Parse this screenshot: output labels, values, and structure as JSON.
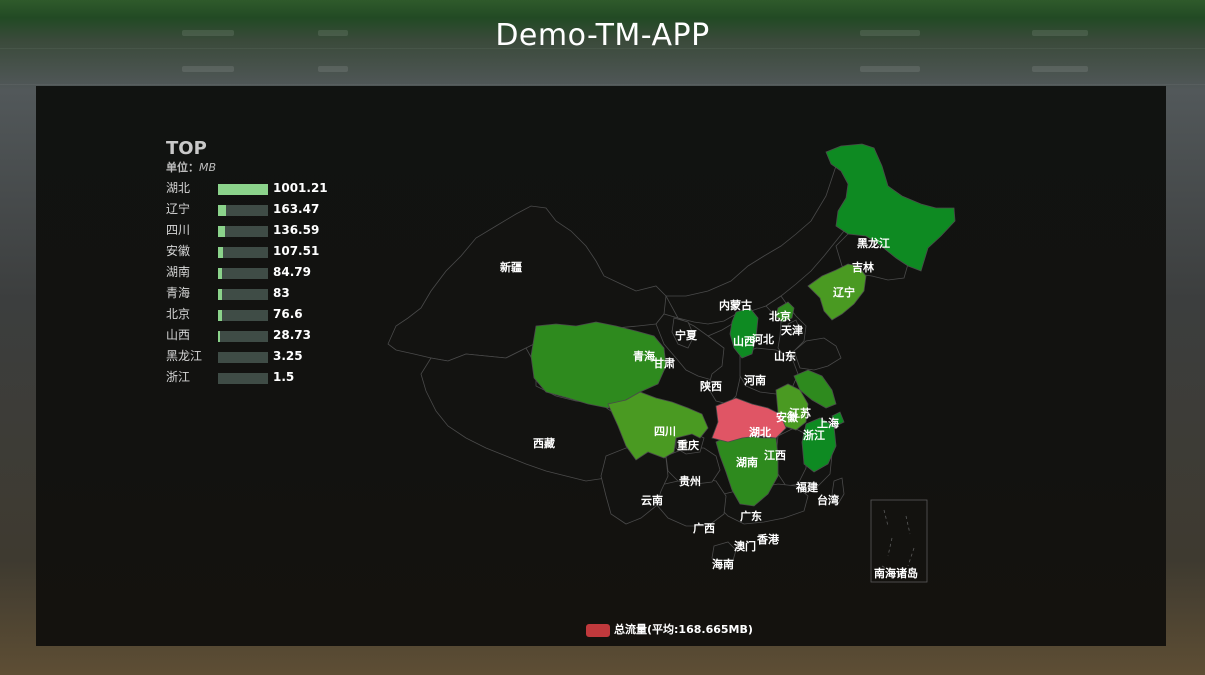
{
  "app": {
    "title": "Demo-TM-APP"
  },
  "top_list": {
    "title": "TOP",
    "unit_label": "单位：",
    "unit_value": "MB",
    "max_value": 1001.21,
    "items": [
      {
        "name": "湖北",
        "value": "1001.21",
        "num": 1001.21
      },
      {
        "name": "辽宁",
        "value": "163.47",
        "num": 163.47
      },
      {
        "name": "四川",
        "value": "136.59",
        "num": 136.59
      },
      {
        "name": "安徽",
        "value": "107.51",
        "num": 107.51
      },
      {
        "name": "湖南",
        "value": "84.79",
        "num": 84.79
      },
      {
        "name": "青海",
        "value": "83",
        "num": 83
      },
      {
        "name": "北京",
        "value": "76.6",
        "num": 76.6
      },
      {
        "name": "山西",
        "value": "28.73",
        "num": 28.73
      },
      {
        "name": "黑龙江",
        "value": "3.25",
        "num": 3.25
      },
      {
        "name": "浙江",
        "value": "1.5",
        "num": 1.5
      }
    ]
  },
  "map": {
    "province_labels": [
      "新疆",
      "西藏",
      "青海",
      "甘肃",
      "宁夏",
      "内蒙古",
      "陕西",
      "四川",
      "重庆",
      "云南",
      "贵州",
      "广西",
      "广东",
      "海南",
      "澳门",
      "香港",
      "湖南",
      "湖北",
      "河南",
      "山西",
      "河北",
      "北京",
      "天津",
      "山东",
      "江苏",
      "安徽",
      "上海",
      "浙江",
      "江西",
      "福建",
      "台湾",
      "辽宁",
      "吉林",
      "黑龙江",
      "南海诸岛"
    ],
    "colors": {
      "highlight": "#e05565",
      "dark_green": "#0e8a22",
      "mid_green": "#2e8a1e",
      "light_green": "#4a9a22",
      "base": "#131311",
      "border": "#4a4a4a"
    }
  },
  "legend": {
    "label": "总流量(平均:168.665MB)",
    "color": "#c0393c"
  }
}
